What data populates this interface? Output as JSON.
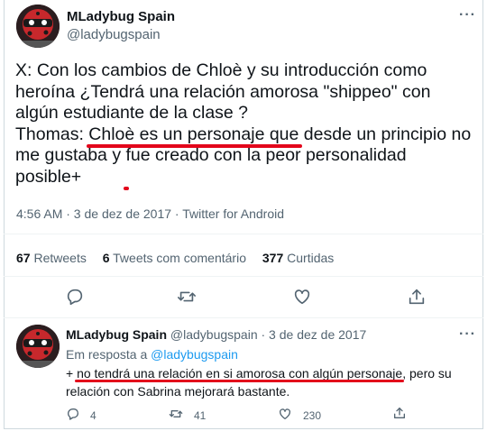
{
  "tweet": {
    "author_name": "MLadybug Spain",
    "author_handle": "@ladybugspain",
    "more_icon": "···",
    "text_line1": "X: Con los cambios de Chloè y su introducción como heroína  ¿Tendrá una relación amorosa \"shippeo\" con algún estudiante de la clase ?",
    "text_thomas": "Thomas: ",
    "text_ul1": "Chloè es un personaje que",
    "text_mid": " desde un principio no me gustaba y ",
    "text_ul2": "fue creado con la peor personalidad posible+",
    "timestamp": "4:56 AM · 3 de dez de 2017 · Twitter for Android",
    "retweets_count": "67",
    "retweets_label": "Retweets",
    "quotes_count": "6",
    "quotes_label": "Tweets com comentário",
    "likes_count": "377",
    "likes_label": "Curtidas"
  },
  "reply": {
    "author_name": "MLadybug Spain",
    "author_handle_date": "@ladybugspain · 3 de dez de 2017",
    "replying_prefix": "Em resposta a ",
    "replying_to": "@ladybugspain",
    "text_pre": "+ ",
    "text_ul": "no tendrá una relación en si amorosa con algún personaje",
    "text_post": ", pero su relación con Sabrina mejorará bastante.",
    "reply_count": "4",
    "retweet_count": "41",
    "like_count": "230"
  },
  "icons": {
    "reply": "reply-icon",
    "retweet": "retweet-icon",
    "like": "like-icon",
    "share": "share-icon",
    "more": "more-icon"
  },
  "colors": {
    "underline": "#e3061b",
    "link": "#1d9bf0",
    "secondary_text": "#536471",
    "primary_text": "#0f1419"
  }
}
